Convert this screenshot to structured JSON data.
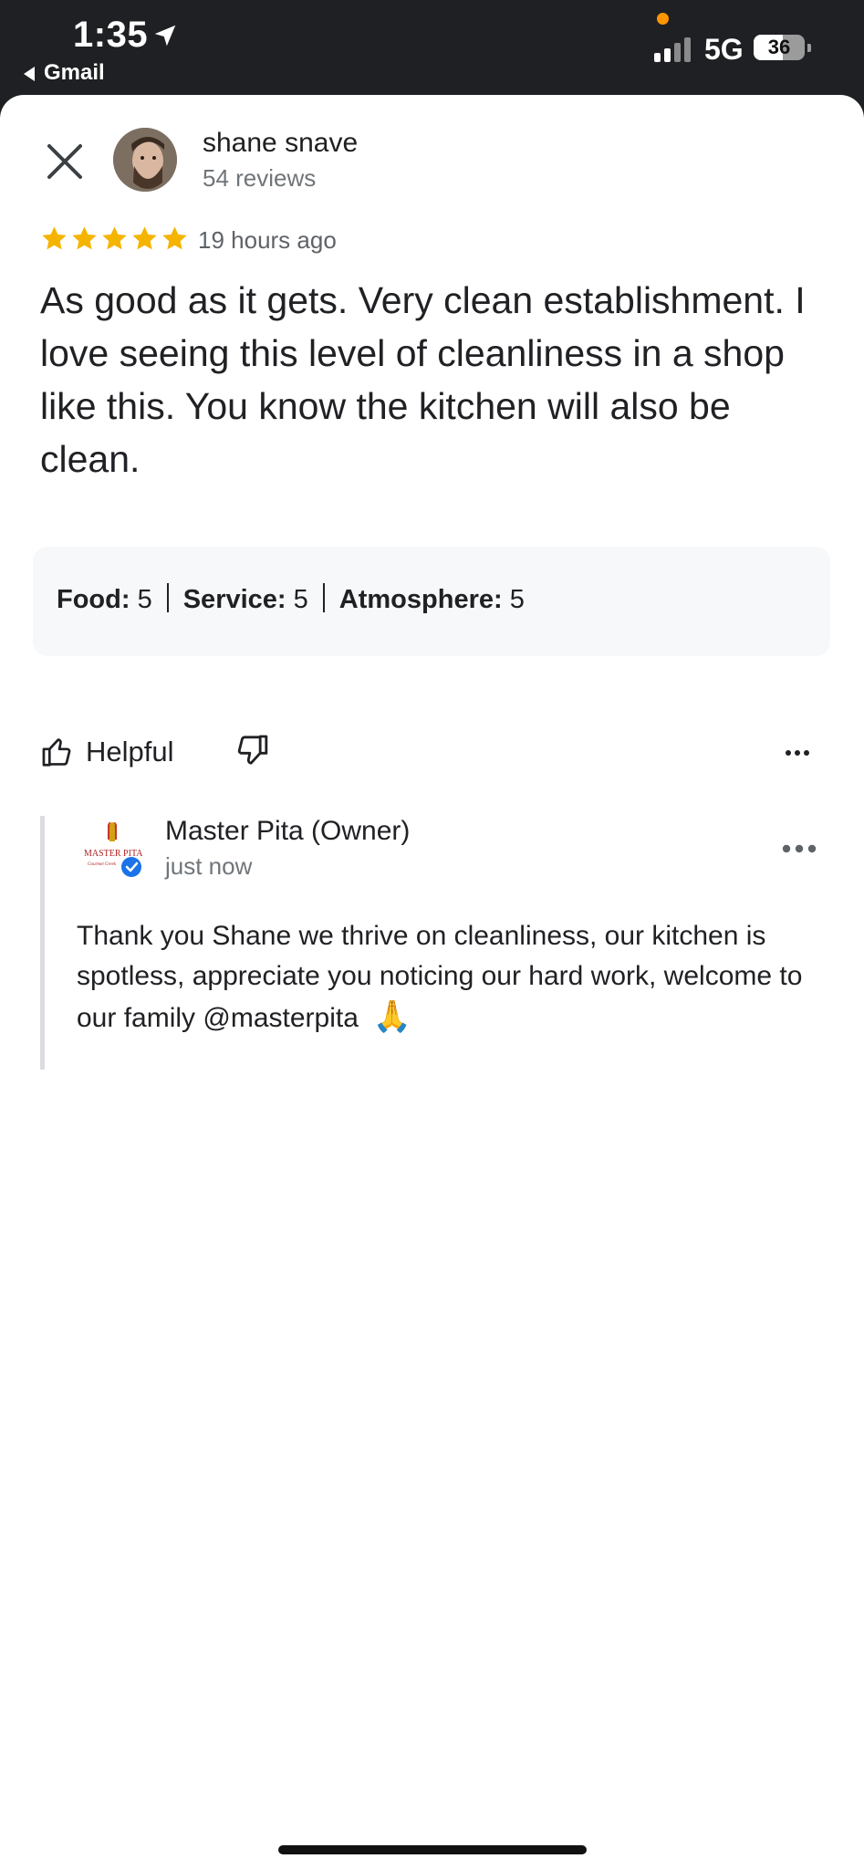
{
  "status_bar": {
    "time": "1:35",
    "back_app": "Gmail",
    "network": "5G",
    "battery": "36"
  },
  "review": {
    "reviewer_name": "shane snave",
    "reviewer_reviews": "54 reviews",
    "rating": 5,
    "time_ago": "19 hours ago",
    "text": "As good as it gets. Very clean establishment. I love seeing this level of cleanliness in a shop like this. You know the kitchen will also be clean.",
    "ratings": [
      {
        "label": "Food:",
        "value": "5"
      },
      {
        "label": "Service:",
        "value": "5"
      },
      {
        "label": "Atmosphere:",
        "value": "5"
      }
    ],
    "helpful_label": "Helpful"
  },
  "owner_response": {
    "name": "Master Pita (Owner)",
    "when": "just now",
    "text": "Thank you Shane we thrive on cleanliness, our kitchen is spotless, appreciate you noticing our hard work, welcome to our family @masterpita",
    "emoji": "🙏",
    "logo_text": "MASTER PITA"
  },
  "icons": {
    "close": "close-icon",
    "star": "star-icon",
    "thumbs_up": "thumbs-up-icon",
    "thumbs_down": "thumbs-down-icon",
    "more": "more-options-icon",
    "verified": "verified-badge-icon"
  },
  "colors": {
    "star": "#f5b400",
    "verified": "#1a73e8",
    "ratings_bg": "#f7f8f9",
    "status_bar_bg": "#1f2023"
  }
}
